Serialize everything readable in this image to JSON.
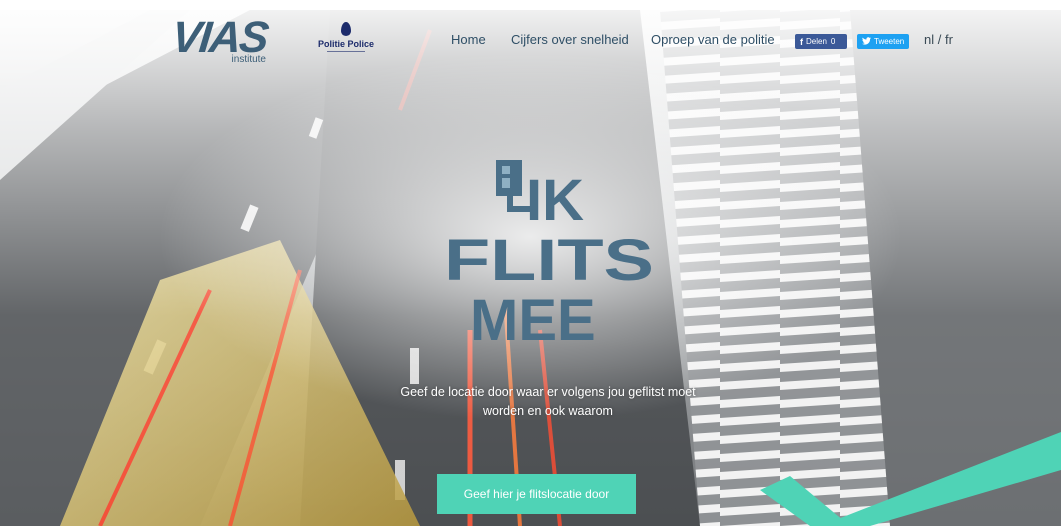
{
  "header": {
    "vias_logo": "VIAS",
    "vias_sub": "institute",
    "police_logo": "Politie Police",
    "nav": [
      {
        "label": "Home"
      },
      {
        "label": "Cijfers over snelheid"
      },
      {
        "label": "Oproep van de politie"
      }
    ],
    "share": {
      "facebook_label": "Delen",
      "facebook_count": "0",
      "twitter_label": "Tweeten"
    },
    "lang": {
      "nl": "nl",
      "separator": " / ",
      "fr": "fr"
    }
  },
  "hero": {
    "title_lines": [
      "IK",
      "FLITS",
      "MEE"
    ],
    "tagline": "Geef de locatie door waar er volgens jou geflitst moet worden en ook waarom",
    "cta_label": "Geef hier je flitslocatie door"
  },
  "colors": {
    "accent": "#4fd3b6",
    "title": "#4a6f88",
    "brand_dark": "#3d5f78",
    "facebook": "#3b5998",
    "twitter": "#1da1f2"
  },
  "icons": {
    "facebook": "facebook-icon",
    "twitter": "twitter-icon",
    "camera": "speed-camera-icon",
    "police": "police-flame-icon"
  }
}
